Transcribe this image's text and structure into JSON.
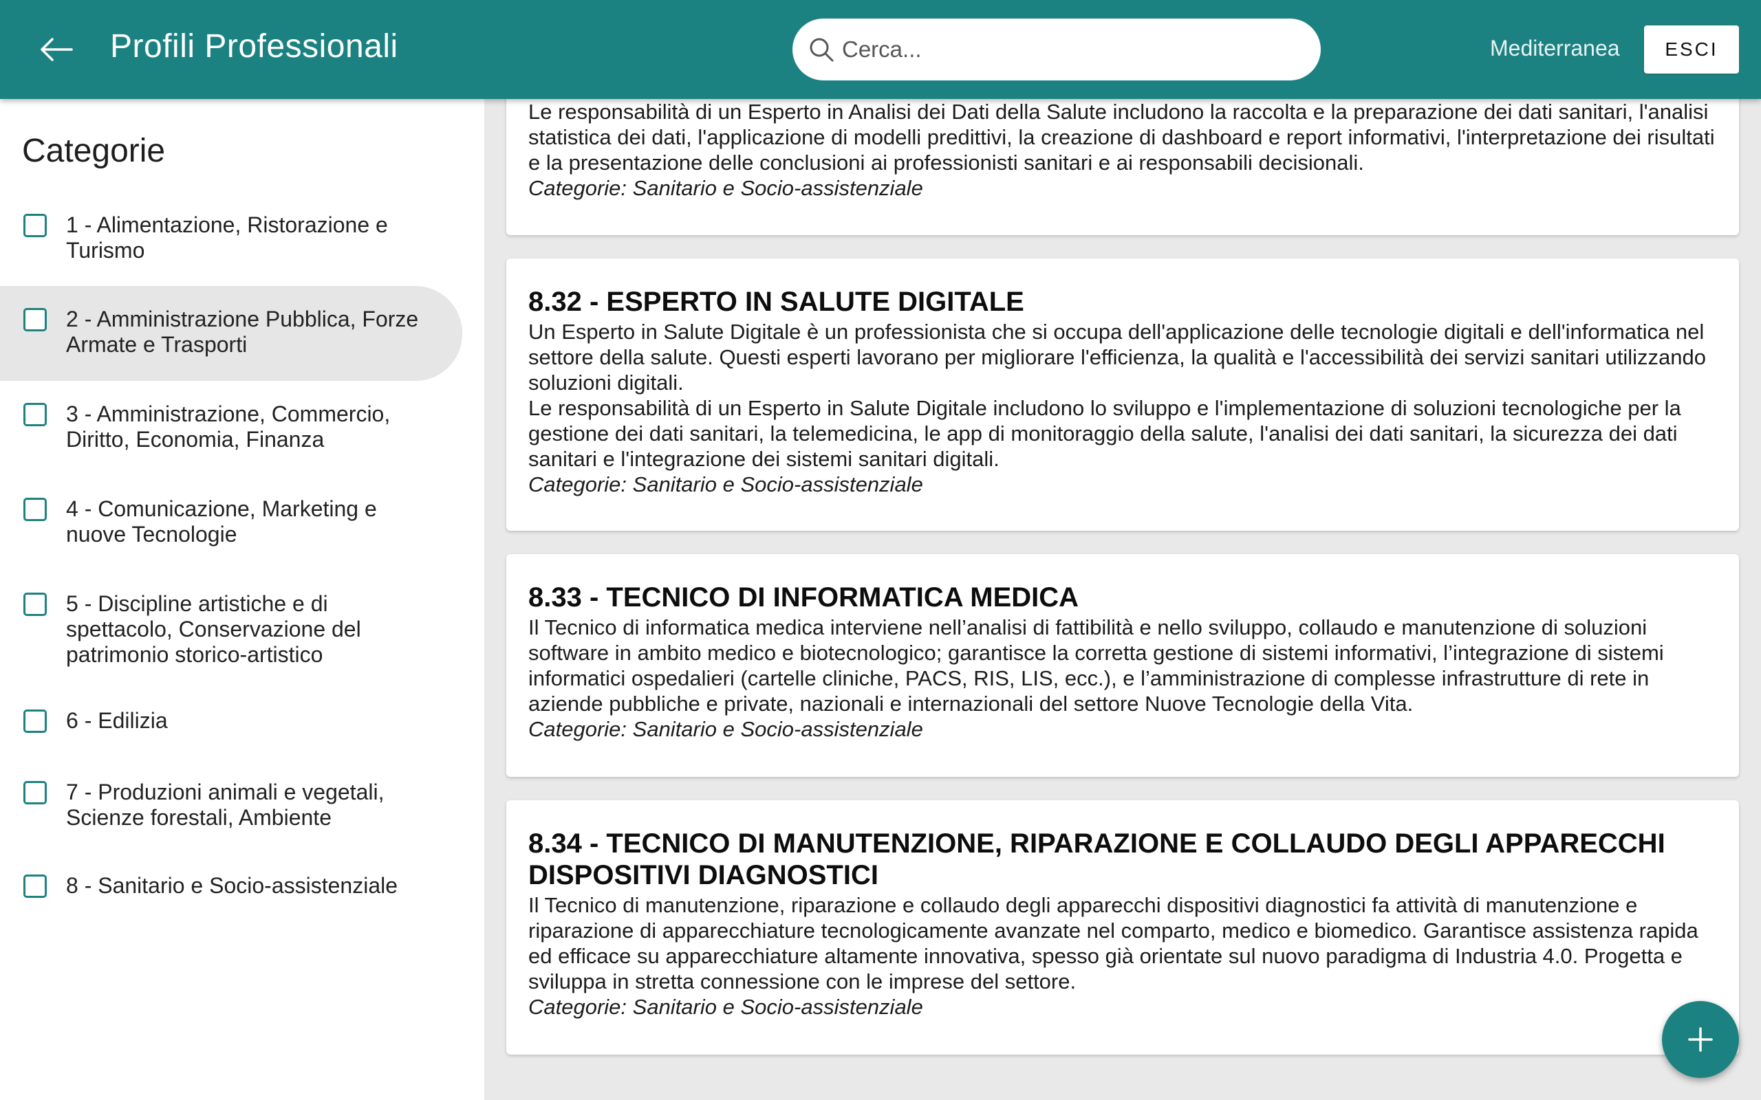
{
  "header": {
    "title": "Profili Professionali",
    "search_placeholder": "Cerca...",
    "user": "Mediterranea",
    "exit_label": "ESCI"
  },
  "sidebar": {
    "title": "Categorie",
    "items": [
      {
        "label": "1 - Alimentazione, Ristorazione e Turismo",
        "checked": false,
        "selected": false
      },
      {
        "label": "2 - Amministrazione Pubblica, Forze Armate e Trasporti",
        "checked": false,
        "selected": true
      },
      {
        "label": "3 - Amministrazione, Commercio, Diritto, Economia, Finanza",
        "checked": false,
        "selected": false
      },
      {
        "label": "4 - Comunicazione, Marketing e nuove Tecnologie",
        "checked": false,
        "selected": false
      },
      {
        "label": "5 - Discipline artistiche e di spettacolo, Conservazione del patrimonio storico-artistico",
        "checked": false,
        "selected": false
      },
      {
        "label": "6 - Edilizia",
        "checked": false,
        "selected": false
      },
      {
        "label": "7 - Produzioni animali e vegetali, Scienze forestali, Ambiente",
        "checked": false,
        "selected": false
      },
      {
        "label": "8 - Sanitario e Socio-assistenziale",
        "checked": false,
        "selected": false
      }
    ]
  },
  "cards": [
    {
      "title": "",
      "description": "Le responsabilità di un Esperto in Analisi dei Dati della Salute includono la raccolta e la preparazione dei dati sanitari, l'analisi statistica dei dati, l'applicazione di modelli predittivi, la creazione di dashboard e report informativi, l'interpretazione dei risultati e la presentazione delle conclusioni ai professionisti sanitari e ai responsabili decisionali.",
      "category_label": "Categorie",
      "category_value": ": Sanitario e Socio-assistenziale"
    },
    {
      "title": "8.32 - ESPERTO IN SALUTE DIGITALE",
      "description": "Un Esperto in Salute Digitale è un professionista che si occupa dell'applicazione delle tecnologie digitali e dell'informatica nel settore della salute. Questi esperti lavorano per migliorare l'efficienza, la qualità e l'accessibilità dei servizi sanitari utilizzando soluzioni digitali.\nLe responsabilità di un Esperto in Salute Digitale includono lo sviluppo e l'implementazione di soluzioni tecnologiche per la gestione dei dati sanitari, la telemedicina, le app di monitoraggio della salute, l'analisi dei dati sanitari, la sicurezza dei dati sanitari e l'integrazione dei sistemi sanitari digitali.",
      "category_label": "Categorie",
      "category_value": ": Sanitario e Socio-assistenziale"
    },
    {
      "title": "8.33 - TECNICO DI INFORMATICA MEDICA",
      "description": "Il Tecnico di informatica medica interviene nell’analisi di fattibilità e nello sviluppo, collaudo e manutenzione di soluzioni software in ambito medico e biotecnologico; garantisce la corretta gestione di sistemi informativi, l’integrazione di sistemi informatici ospedalieri (cartelle cliniche, PACS, RIS, LIS, ecc.), e l’amministrazione di complesse infrastrutture di rete in aziende pubbliche e private, nazionali e internazionali del settore Nuove Tecnologie della Vita.",
      "category_label": "Categorie",
      "category_value": ": Sanitario e Socio-assistenziale"
    },
    {
      "title": "8.34 - TECNICO DI MANUTENZIONE, RIPARAZIONE E COLLAUDO DEGLI APPARECCHI DISPOSITIVI DIAGNOSTICI",
      "description": "Il Tecnico di manutenzione, riparazione e collaudo degli apparecchi dispositivi diagnostici fa attività di manutenzione e riparazione di apparecchiature tecnologicamente avanzate nel comparto, medico e biomedico. Garantisce assistenza rapida ed efficace su apparecchiature altamente innovativa, spesso già orientate sul nuovo paradigma di Industria 4.0. Progetta e sviluppa in stretta connessione con le imprese del settore.",
      "category_label": "Categorie",
      "category_value": ": Sanitario e Socio-assistenziale"
    }
  ],
  "colors": {
    "primary": "#1c8281",
    "background": "#e9e9e9",
    "card": "#ffffff",
    "selected_item": "#e6e6e6"
  },
  "icons": {
    "back": "arrow-left-icon",
    "search": "search-icon",
    "fab": "plus-icon"
  }
}
